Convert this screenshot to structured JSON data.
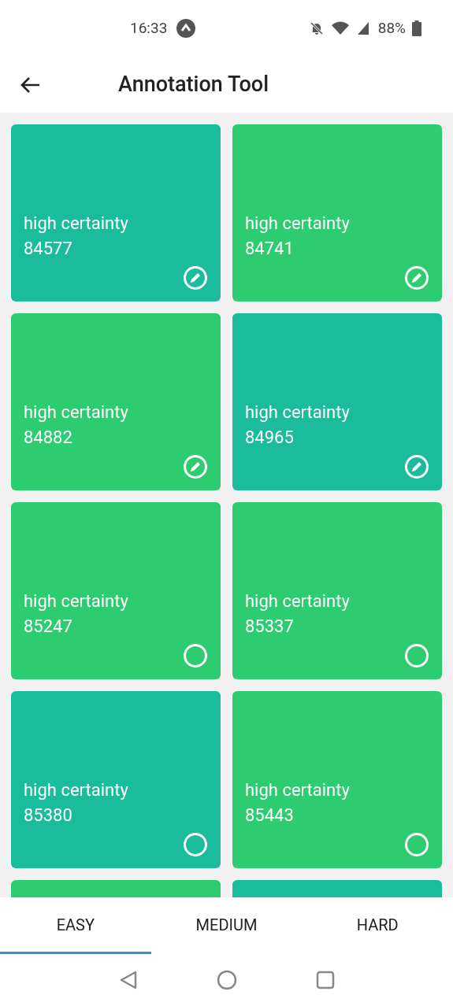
{
  "status_bar": {
    "time": "16:33",
    "battery": "88%"
  },
  "header": {
    "title": "Annotation Tool"
  },
  "cards": [
    {
      "label": "high certainty",
      "id": "84577",
      "color": "#1abc9c",
      "annotated": true
    },
    {
      "label": "high certainty",
      "id": "84741",
      "color": "#2ecc71",
      "annotated": true
    },
    {
      "label": "high certainty",
      "id": "84882",
      "color": "#2ecc71",
      "annotated": true
    },
    {
      "label": "high certainty",
      "id": "84965",
      "color": "#1abc9c",
      "annotated": true
    },
    {
      "label": "high certainty",
      "id": "85247",
      "color": "#2ecc71",
      "annotated": false
    },
    {
      "label": "high certainty",
      "id": "85337",
      "color": "#2ecc71",
      "annotated": false
    },
    {
      "label": "high certainty",
      "id": "85380",
      "color": "#1abc9c",
      "annotated": false
    },
    {
      "label": "high certainty",
      "id": "85443",
      "color": "#2ecc71",
      "annotated": false
    },
    {
      "color": "#2ecc71"
    },
    {
      "color": "#1abc9c"
    }
  ],
  "tabs": [
    {
      "label": "EASY",
      "selected": true
    },
    {
      "label": "MEDIUM",
      "selected": false
    },
    {
      "label": "HARD",
      "selected": false
    }
  ]
}
